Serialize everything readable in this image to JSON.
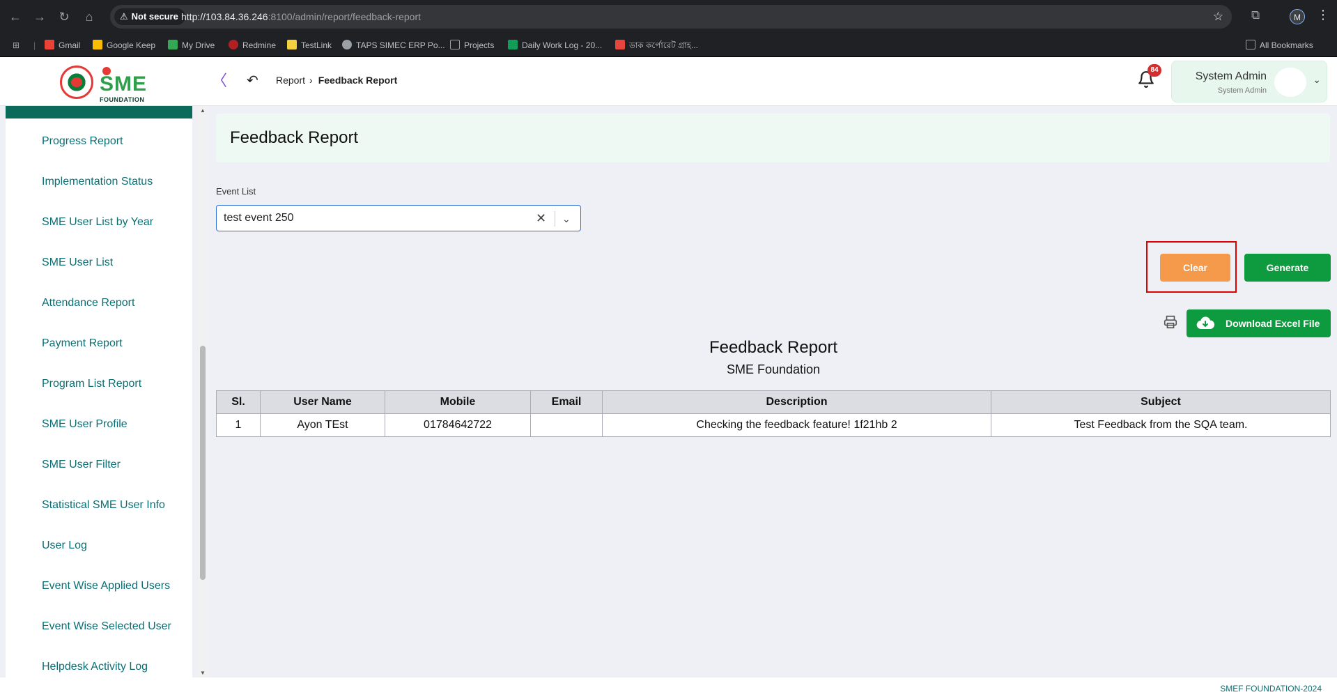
{
  "browser": {
    "security_label": "Not secure",
    "url_host": "http://103.84.36.246",
    "url_path": ":8100/admin/report/feedback-report",
    "profile_initial": "M",
    "bookmarks": [
      {
        "label": "Gmail",
        "color": "#ea4335"
      },
      {
        "label": "Google Keep",
        "color": "#fbbc04"
      },
      {
        "label": "My Drive",
        "color": "#34a853"
      },
      {
        "label": "Redmine",
        "color": "#b32024"
      },
      {
        "label": "TestLink",
        "color": "#f4d03f"
      },
      {
        "label": "TAPS SIMEC ERP Po...",
        "color": "#9aa0a6"
      },
      {
        "label": "Projects",
        "color": "#9aa0a6"
      },
      {
        "label": "Daily Work Log - 20...",
        "color": "#0f9d58"
      },
      {
        "label": "ডাক কর্পোরেট গ্রাহ...",
        "color": "#e8453c"
      }
    ],
    "all_bookmarks": "All Bookmarks"
  },
  "header": {
    "logo_text": "SME",
    "logo_subtext": "FOUNDATION",
    "breadcrumb_parent": "Report",
    "breadcrumb_current": "Feedback Report",
    "notification_count": "84",
    "user_name": "System Admin",
    "user_role": "System Admin"
  },
  "sidebar": {
    "items": [
      {
        "label": "Progress Report"
      },
      {
        "label": "Implementation Status"
      },
      {
        "label": "SME User List by Year"
      },
      {
        "label": "SME User List"
      },
      {
        "label": "Attendance Report"
      },
      {
        "label": "Payment Report"
      },
      {
        "label": "Program List Report"
      },
      {
        "label": "SME User Profile"
      },
      {
        "label": "SME User Filter"
      },
      {
        "label": "Statistical SME User Info"
      },
      {
        "label": "User Log"
      },
      {
        "label": "Event Wise Applied Users"
      },
      {
        "label": "Event Wise Selected User"
      },
      {
        "label": "Helpdesk Activity Log"
      }
    ]
  },
  "main": {
    "page_title": "Feedback Report",
    "event_list_label": "Event List",
    "event_selected": "test event 250",
    "clear_label": "Clear",
    "generate_label": "Generate",
    "download_label": "Download Excel File",
    "report_title": "Feedback Report",
    "report_subtitle": "SME Foundation",
    "table": {
      "columns": [
        "Sl.",
        "User Name",
        "Mobile",
        "Email",
        "Description",
        "Subject"
      ],
      "rows": [
        [
          "1",
          "Ayon TEst",
          "01784642722",
          "",
          "Checking the feedback feature! 1f21hb 2",
          "Test Feedback from the SQA team."
        ]
      ]
    }
  },
  "footer": {
    "text": "SMEF FOUNDATION-2024"
  },
  "colors": {
    "brand_green": "#0e9a3e",
    "clear_orange": "#f59a4a",
    "sidebar_text": "#0b6e73",
    "highlight_red": "#e00000"
  }
}
